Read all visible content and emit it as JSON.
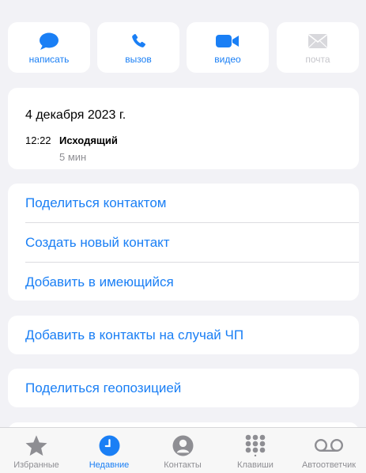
{
  "actions": {
    "message": "написать",
    "call": "вызов",
    "video": "видео",
    "mail": "почта"
  },
  "recent_call": {
    "date": "4 декабря 2023 г.",
    "time": "12:22",
    "direction": "Исходящий",
    "duration": "5 мин"
  },
  "menu": {
    "share_contact": "Поделиться контактом",
    "create_contact": "Создать новый контакт",
    "add_existing": "Добавить в имеющийся",
    "add_emergency": "Добавить в контакты на случай ЧП",
    "share_location": "Поделиться геопозицией"
  },
  "tabbar": {
    "favorites": "Избранные",
    "recents": "Недавние",
    "contacts": "Контакты",
    "keypad": "Клавиши",
    "voicemail": "Автоответчик"
  },
  "icons": {
    "message": "speech-bubble-icon",
    "call": "phone-icon",
    "video": "video-camera-icon",
    "mail": "envelope-icon",
    "favorites": "star-icon",
    "recents": "clock-icon",
    "contacts": "person-circle-icon",
    "keypad": "keypad-icon",
    "voicemail": "voicemail-icon"
  },
  "colors": {
    "accent": "#1a7ff5",
    "disabled": "#c6c6cb",
    "secondary_text": "#8e8e93",
    "background": "#f2f2f6"
  }
}
